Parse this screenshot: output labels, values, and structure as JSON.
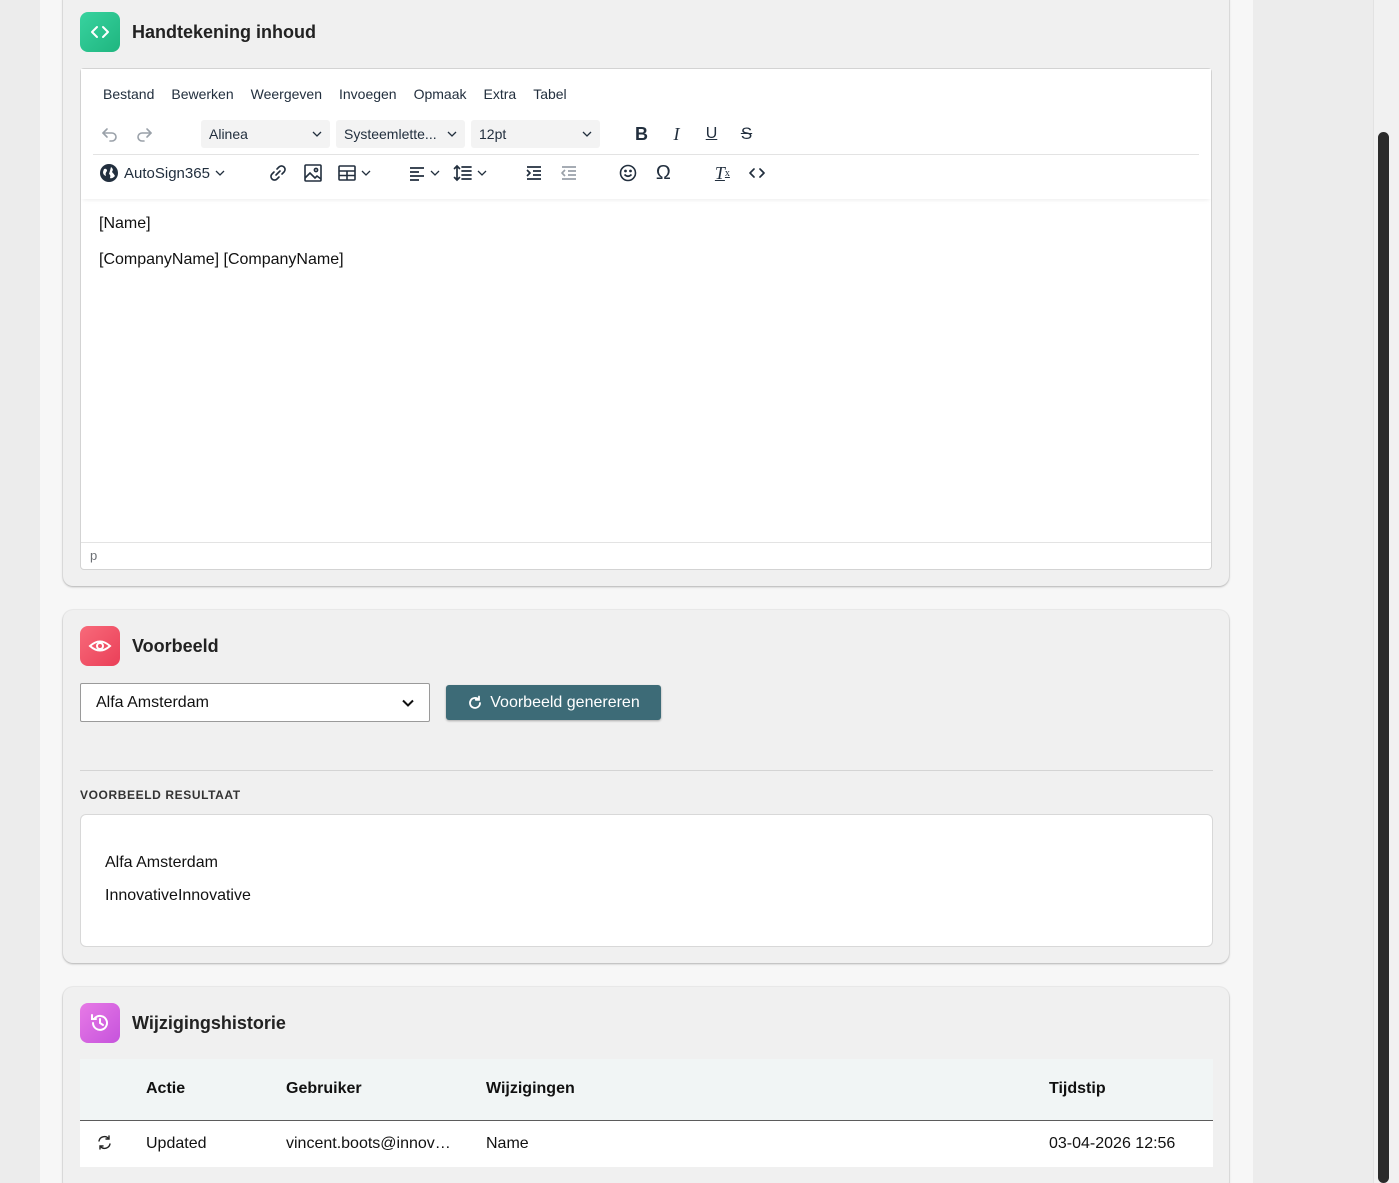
{
  "editor_card": {
    "title": "Handtekening inhoud",
    "badge_icon": "code-icon",
    "badge_color": "#2ecc8f",
    "menu": [
      "Bestand",
      "Bewerken",
      "Weergeven",
      "Invoegen",
      "Opmaak",
      "Extra",
      "Tabel"
    ],
    "block_format": "Alinea",
    "font_family": "Systeemlette...",
    "font_size": "12pt",
    "autosign_label": "AutoSign365",
    "content_lines": [
      "[Name]",
      "[CompanyName] [CompanyName]"
    ],
    "status_path": "p"
  },
  "preview_card": {
    "title": "Voorbeeld",
    "badge_icon": "eye-icon",
    "badge_color": "#f0546a",
    "selected_company": "Alfa Amsterdam",
    "generate_label": "Voorbeeld genereren",
    "result_label": "VOORBEELD RESULTAAT",
    "result_lines": [
      "Alfa Amsterdam",
      "InnovativeInnovative"
    ]
  },
  "history_card": {
    "title": "Wijzigingshistorie",
    "badge_icon": "history-icon",
    "badge_color": "#d96be0",
    "columns": {
      "action": "Actie",
      "user": "Gebruiker",
      "changes": "Wijzigingen",
      "time": "Tijdstip"
    },
    "rows": [
      {
        "action": "Updated",
        "user": "vincent.boots@innov…",
        "changes": "Name",
        "time": "03-04-2026 12:56"
      }
    ]
  }
}
